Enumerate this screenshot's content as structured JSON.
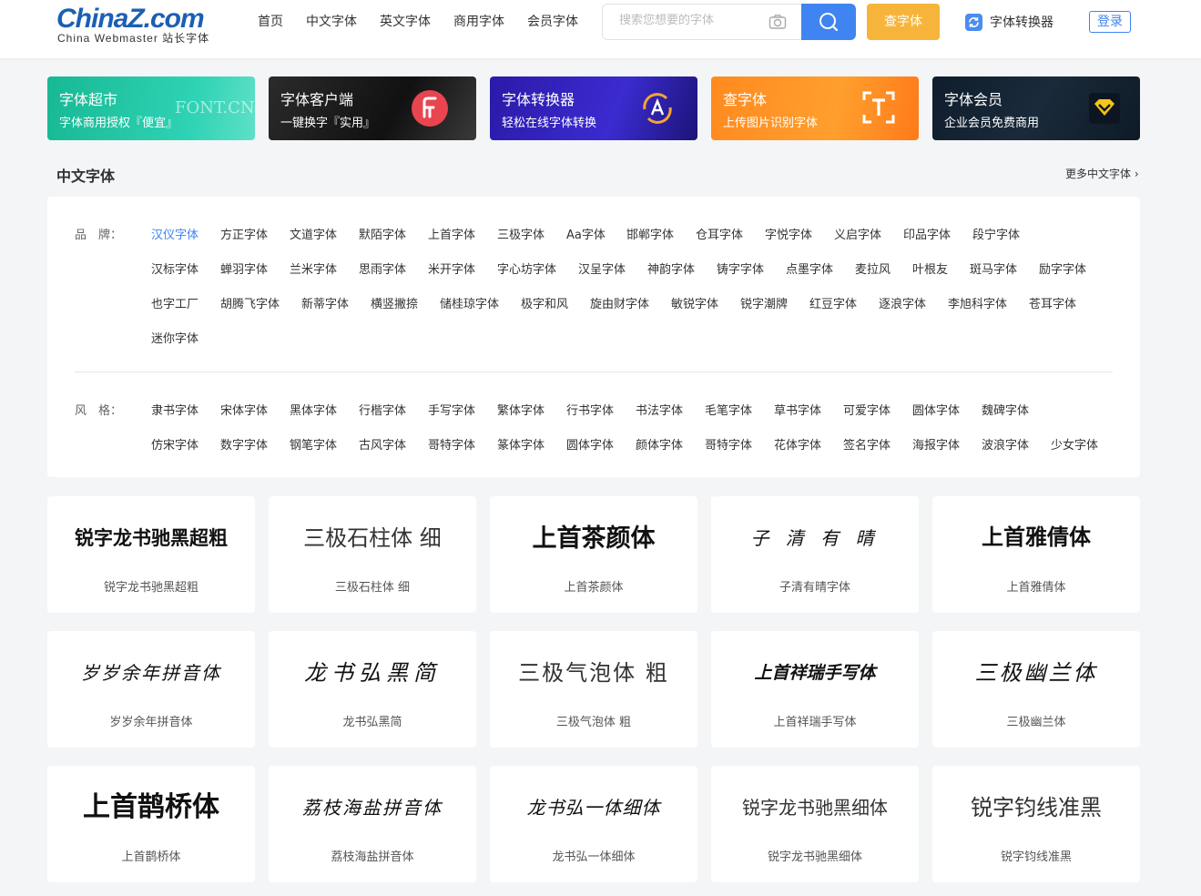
{
  "header": {
    "logo_main": "ChinaZ.com",
    "logo_sub": "China Webmaster 站长字体",
    "nav": [
      "首页",
      "中文字体",
      "英文字体",
      "商用字体",
      "会员字体"
    ],
    "search_placeholder": "搜索您想要的字体",
    "find_font_label": "查字体",
    "converter_label": "字体转换器",
    "login_label": "登录"
  },
  "banners": [
    {
      "title": "字体超市",
      "subtitle": "字体商用授权『便宜』",
      "watermark": "FONT.CN",
      "color": "#1fc39e"
    },
    {
      "title": "字体客户端",
      "subtitle": "一键换字『实用』",
      "color": "#1e1e1e"
    },
    {
      "title": "字体转换器",
      "subtitle": "轻松在线字体转换",
      "color": "#2f22b8"
    },
    {
      "title": "查字体",
      "subtitle": "上传图片识别字体",
      "color": "#ff8d22"
    },
    {
      "title": "字体会员",
      "subtitle": "企业会员免费商用",
      "color": "#142232"
    }
  ],
  "section": {
    "title": "中文字体",
    "more": "更多中文字体 ›"
  },
  "filters": {
    "brand_label": "品　牌：",
    "brand_tags": [
      [
        "汉仪字体",
        "方正字体",
        "文道字体",
        "默陌字体",
        "上首字体",
        "三极字体",
        "Aa字体",
        "邯郸字体",
        "仓耳字体",
        "字悦字体",
        "义启字体",
        "印品字体",
        "段宁字体"
      ],
      [
        "汉标字体",
        "蝉羽字体",
        "兰米字体",
        "思雨字体",
        "米开字体",
        "字心坊字体",
        "汉呈字体",
        "神韵字体",
        "铸字字体",
        "点墨字体",
        "麦拉风",
        "叶根友",
        "斑马字体",
        "励字字体"
      ],
      [
        "也字工厂",
        "胡腾飞字体",
        "新蒂字体",
        "横竖撇捺",
        "储桂琼字体",
        "极字和风",
        "旋由财字体",
        "敏锐字体",
        "锐字潮牌",
        "红豆字体",
        "逐浪字体",
        "李旭科字体",
        "苍耳字体"
      ],
      [
        "迷你字体"
      ]
    ],
    "style_label": "风　格：",
    "style_tags": [
      [
        "隶书字体",
        "宋体字体",
        "黑体字体",
        "行楷字体",
        "手写字体",
        "繁体字体",
        "行书字体",
        "书法字体",
        "毛笔字体",
        "草书字体",
        "可爱字体",
        "圆体字体",
        "魏碑字体"
      ],
      [
        "仿宋字体",
        "数字字体",
        "钢笔字体",
        "古风字体",
        "哥特字体",
        "篆体字体",
        "圆体字体",
        "颜体字体",
        "哥特字体",
        "花体字体",
        "签名字体",
        "海报字体",
        "波浪字体",
        "少女字体"
      ]
    ]
  },
  "fonts": [
    {
      "preview": "锐字龙书驰黑超粗",
      "name": "锐字龙书驰黑超粗",
      "style": "bold"
    },
    {
      "preview": "三极石柱体 细",
      "name": "三极石柱体 细",
      "style": "thin"
    },
    {
      "preview": "上首茶颜体",
      "name": "上首茶颜体",
      "style": "serif"
    },
    {
      "preview": "子 清 有 晴",
      "name": "子清有晴字体",
      "style": "hand"
    },
    {
      "preview": "上首雅倩体",
      "name": "上首雅倩体",
      "style": "serif"
    },
    {
      "preview": "岁岁余年拼音体",
      "name": "岁岁余年拼音体",
      "style": "hand"
    },
    {
      "preview": "龙书弘黑简",
      "name": "龙书弘黑简",
      "style": "hand"
    },
    {
      "preview": "三极气泡体 粗",
      "name": "三极气泡体 粗",
      "style": "thin"
    },
    {
      "preview": "上首祥瑞手写体",
      "name": "上首祥瑞手写体",
      "style": "bold"
    },
    {
      "preview": "三极幽兰体",
      "name": "三极幽兰体",
      "style": "hand"
    },
    {
      "preview": "上首鹊桥体",
      "name": "上首鹊桥体",
      "style": "serif"
    },
    {
      "preview": "荔枝海盐拼音体",
      "name": "荔枝海盐拼音体",
      "style": "hand"
    },
    {
      "preview": "龙书弘一体细体",
      "name": "龙书弘一体细体",
      "style": "hand"
    },
    {
      "preview": "锐字龙书驰黑细体",
      "name": "锐字龙书驰黑细体",
      "style": "thin"
    },
    {
      "preview": "锐字钧线准黑",
      "name": "锐字钧线准黑",
      "style": "thin"
    }
  ]
}
